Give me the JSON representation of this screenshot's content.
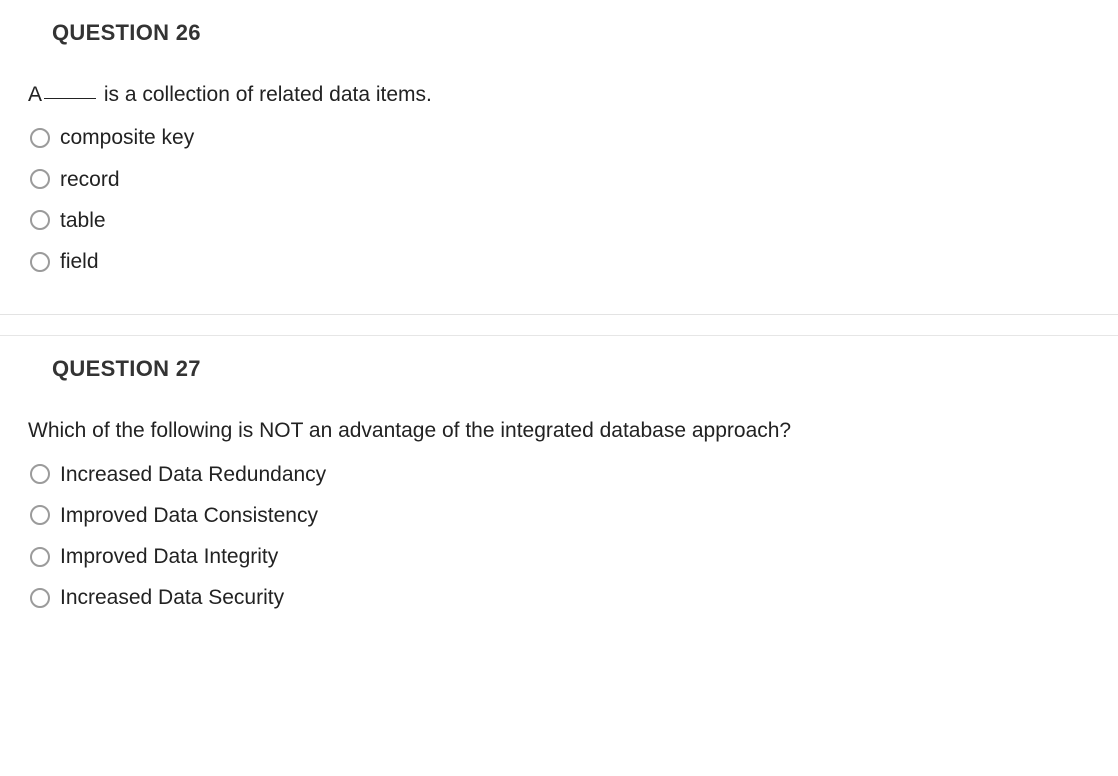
{
  "questions": [
    {
      "title": "QUESTION 26",
      "prompt_prefix": "A",
      "prompt_suffix": " is a collection of related data items.",
      "has_blank": true,
      "options": [
        "composite key",
        "record",
        "table",
        "field"
      ]
    },
    {
      "title": "QUESTION 27",
      "prompt_prefix": "Which of the following is NOT an advantage of the integrated database approach?",
      "prompt_suffix": "",
      "has_blank": false,
      "options": [
        "Increased Data Redundancy",
        "Improved Data Consistency",
        "Improved Data Integrity",
        "Increased Data Security"
      ]
    }
  ]
}
